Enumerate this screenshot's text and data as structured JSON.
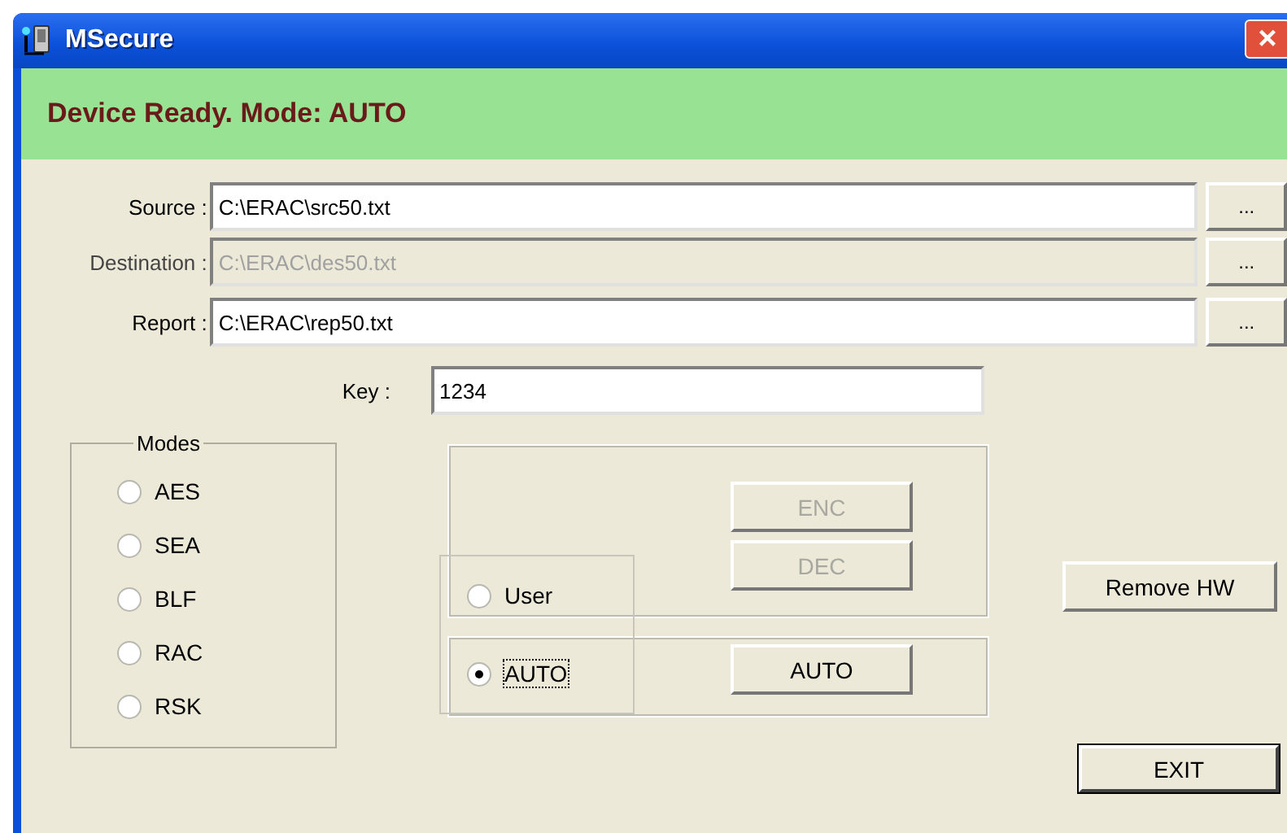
{
  "window": {
    "title": "MSecure",
    "close": "×"
  },
  "status": "Device Ready. Mode: AUTO",
  "paths": [
    {
      "label": "Source :",
      "value": "C:\\ERAC\\src50.txt",
      "disabled": false,
      "browse": "..."
    },
    {
      "label": "Destination :",
      "value": "C:\\ERAC\\des50.txt",
      "disabled": true,
      "browse": "..."
    },
    {
      "label": "Report :",
      "value": "C:\\ERAC\\rep50.txt",
      "disabled": false,
      "browse": "..."
    }
  ],
  "key": {
    "label": "Key :",
    "value": "1234"
  },
  "modes": {
    "title": "Modes",
    "options": [
      {
        "label": "AES",
        "selected": false
      },
      {
        "label": "SEA",
        "selected": false
      },
      {
        "label": "BLF",
        "selected": false
      },
      {
        "label": "RAC",
        "selected": false
      },
      {
        "label": "RSK",
        "selected": false
      }
    ]
  },
  "actions": [
    {
      "label": "ENC",
      "disabled": true
    },
    {
      "label": "DEC",
      "disabled": true
    }
  ],
  "run_mode": [
    {
      "label": "User",
      "selected": false
    },
    {
      "label": "AUTO",
      "selected": true
    }
  ],
  "auto_button": {
    "label": "AUTO",
    "disabled": false
  },
  "remove_button": "Remove HW",
  "exit_button": "EXIT"
}
